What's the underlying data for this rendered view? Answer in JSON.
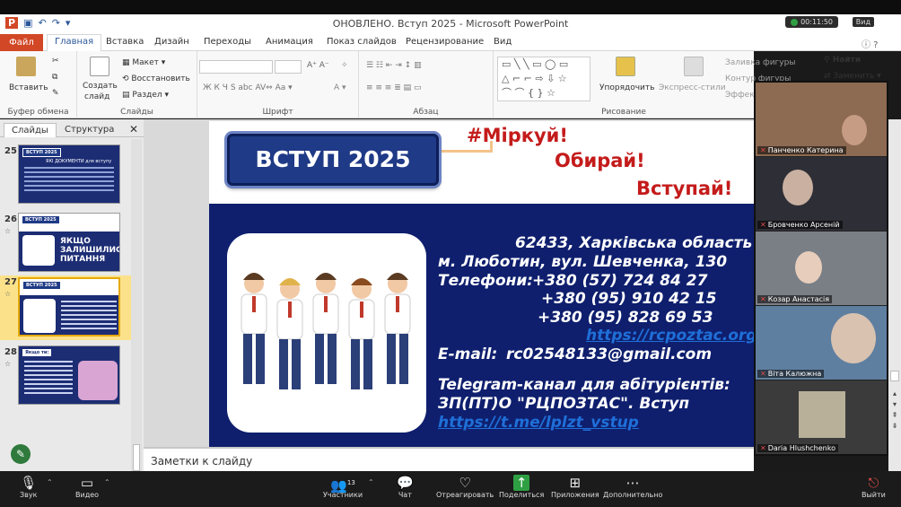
{
  "window": {
    "title": "ОНОВЛЕНО. Вступ 2025 - Microsoft PowerPoint",
    "rec_time": "00:11:50",
    "view_label": "Вид"
  },
  "ribbon_tabs": [
    "Файл",
    "Главная",
    "Вставка",
    "Дизайн",
    "Переходы",
    "Анимация",
    "Показ слайдов",
    "Рецензирование",
    "Вид"
  ],
  "ribbon": {
    "paste": "Вставить",
    "clipboard": "Буфер обмена",
    "new_slide_1": "Создать",
    "new_slide_2": "слайд",
    "layout": "Макет",
    "reset": "Восстановить",
    "section": "Раздел",
    "slides_group": "Слайды",
    "font_group": "Шрифт",
    "paragraph_group": "Абзац",
    "arrange": "Упорядочить",
    "quick_styles": "Экспресс-стили",
    "drawing_group": "Рисование",
    "shape_fill": "Заливка фигуры",
    "shape_outline": "Контур фигуры",
    "effects": "Эффекты",
    "find": "Найти",
    "replace": "Заменить"
  },
  "panel": {
    "tab_slides": "Слайды",
    "tab_outline": "Структура",
    "close": "✕"
  },
  "thumbnails": [
    {
      "num": "25",
      "title": "ВСТУП 2025",
      "sub": "ЯКІ ДОКУМЕНТИ для вступу"
    },
    {
      "num": "26",
      "title": "ВСТУП 2025",
      "sub": "ЯКЩО ЗАЛИШИЛИСЯ ПИТАННЯ"
    },
    {
      "num": "27",
      "title": "ВСТУП 2025",
      "sub": ""
    },
    {
      "num": "28",
      "title": "Якщо ти:",
      "sub": ""
    }
  ],
  "slide": {
    "badge": "ВСТУП 2025",
    "slogan1": "#Міркуй!",
    "slogan2": "Обирай!",
    "slogan3": "Вступай!",
    "address1": "62433, Харківська область",
    "address2": "м. Люботин, вул. Шевченка, 130",
    "phones_label": "Телефони:",
    "phone1": "+380 (57) 724 84 27",
    "phone2": "+380 (95) 910 42 15",
    "phone3": "+380 (95) 828 69 53",
    "website": "https://rcpoztac.org",
    "email_label": "E-mail:",
    "email": "rc02548133@gmail.com",
    "telegram1": "Telegram-канал для абітурієнтів:",
    "telegram2": "ЗП(ПТ)О \"РЦПОЗТАС\". Вступ",
    "telegram_link": "https://t.me/lplzt_vstup"
  },
  "notes_placeholder": "Заметки к слайду",
  "participants": [
    {
      "name": "Панченко Катерина",
      "bg": "#8d6a52"
    },
    {
      "name": "Бровченко Арсеній",
      "bg": "#2e2e36"
    },
    {
      "name": "Козар Анастасія",
      "bg": "#7a7f86"
    },
    {
      "name": "Віта Калюжна",
      "bg": "#5f7fa0"
    },
    {
      "name": "Daria Hlushchenko",
      "bg": "#3b3b3b"
    }
  ],
  "bottom": {
    "audio": "Звук",
    "video": "Видео",
    "participants": "Участники",
    "participants_count": "13",
    "chat": "Чат",
    "react": "Отреагировать",
    "share": "Поделиться",
    "apps": "Приложения",
    "more": "Дополнительно",
    "leave": "Выйти"
  }
}
